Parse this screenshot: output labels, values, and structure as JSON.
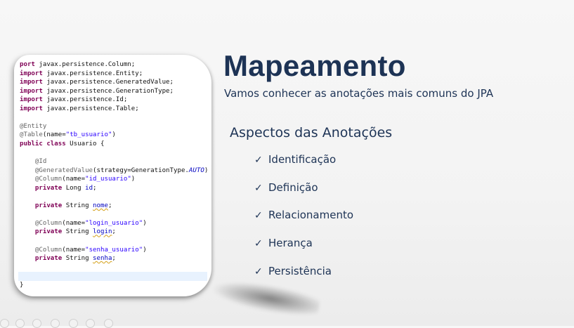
{
  "slide": {
    "title": "Mapeamento",
    "subtitle": "Vamos conhecer as anotações mais comuns do JPA",
    "section_heading": "Aspectos das Anotações",
    "check_glyph": "✓",
    "items": [
      "Identificação",
      "Definição",
      "Relacionamento",
      "Herança",
      "Persistência"
    ]
  },
  "code": {
    "lines": [
      [
        {
          "t": "port",
          "c": "kw"
        },
        {
          "t": " javax.persistence.Column;"
        }
      ],
      [
        {
          "t": "import",
          "c": "kw"
        },
        {
          "t": " javax.persistence.Entity;"
        }
      ],
      [
        {
          "t": "import",
          "c": "kw"
        },
        {
          "t": " javax.persistence.GeneratedValue;"
        }
      ],
      [
        {
          "t": "import",
          "c": "kw"
        },
        {
          "t": " javax.persistence.GenerationType;"
        }
      ],
      [
        {
          "t": "import",
          "c": "kw"
        },
        {
          "t": " javax.persistence.Id;"
        }
      ],
      [
        {
          "t": "import",
          "c": "kw"
        },
        {
          "t": " javax.persistence.Table;"
        }
      ],
      [],
      [
        {
          "t": "@Entity",
          "c": "ann"
        }
      ],
      [
        {
          "t": "@Table",
          "c": "ann"
        },
        {
          "t": "(name="
        },
        {
          "t": "\"tb_usuario\"",
          "c": "str"
        },
        {
          "t": ")"
        }
      ],
      [
        {
          "t": "public class",
          "c": "kw"
        },
        {
          "t": " Usuario {"
        }
      ],
      [],
      [
        {
          "t": "    "
        },
        {
          "t": "@Id",
          "c": "ann"
        }
      ],
      [
        {
          "t": "    "
        },
        {
          "t": "@GeneratedValue",
          "c": "ann"
        },
        {
          "t": "(strategy=GenerationType."
        },
        {
          "t": "AUTO",
          "c": "it"
        },
        {
          "t": ")"
        }
      ],
      [
        {
          "t": "    "
        },
        {
          "t": "@Column",
          "c": "ann"
        },
        {
          "t": "(name="
        },
        {
          "t": "\"id_usuario\"",
          "c": "str"
        },
        {
          "t": ")"
        }
      ],
      [
        {
          "t": "    "
        },
        {
          "t": "private",
          "c": "kw"
        },
        {
          "t": " Long "
        },
        {
          "t": "id",
          "c": "fld"
        },
        {
          "t": ";"
        }
      ],
      [],
      [
        {
          "t": "    "
        },
        {
          "t": "private",
          "c": "kw"
        },
        {
          "t": " String "
        },
        {
          "t": "nome",
          "c": "fld squig"
        },
        {
          "t": ";"
        }
      ],
      [],
      [
        {
          "t": "    "
        },
        {
          "t": "@Column",
          "c": "ann"
        },
        {
          "t": "(name="
        },
        {
          "t": "\"login_usuario\"",
          "c": "str"
        },
        {
          "t": ")"
        }
      ],
      [
        {
          "t": "    "
        },
        {
          "t": "private",
          "c": "kw"
        },
        {
          "t": " String "
        },
        {
          "t": "login",
          "c": "fld squig"
        },
        {
          "t": ";"
        }
      ],
      [],
      [
        {
          "t": "    "
        },
        {
          "t": "@Column",
          "c": "ann"
        },
        {
          "t": "(name="
        },
        {
          "t": "\"senha_usuario\"",
          "c": "str"
        },
        {
          "t": ")"
        }
      ],
      [
        {
          "t": "    "
        },
        {
          "t": "private",
          "c": "kw"
        },
        {
          "t": " String "
        },
        {
          "t": "senha",
          "c": "fld squig"
        },
        {
          "t": ";"
        }
      ],
      [],
      [],
      [
        {
          "t": "}"
        }
      ]
    ]
  },
  "toolbar": {
    "icons": [
      "back-icon",
      "forward-icon",
      "pen-icon",
      "highlighter-icon",
      "zoom-icon",
      "slides-icon",
      "more-icon"
    ]
  }
}
